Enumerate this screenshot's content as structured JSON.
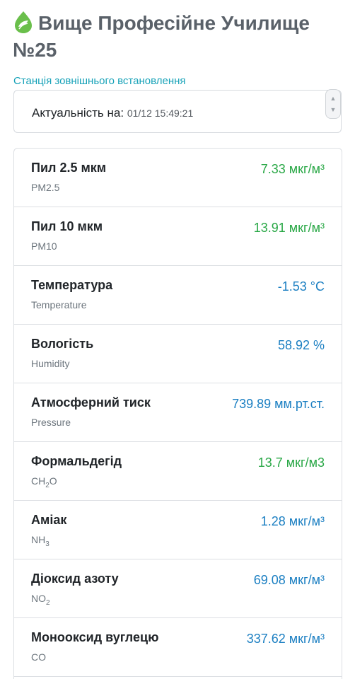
{
  "header": {
    "title": "Вище Професійне Училище №25",
    "station_link": "Станція зовнішнього встановлення",
    "actuality_label": "Актуальність на:",
    "actuality_value": "01/12 15:49:21"
  },
  "measurements": [
    {
      "name": "Пил 2.5 мкм",
      "sub": "PM2.5",
      "value": "7.33 мкг/м³",
      "status": "good"
    },
    {
      "name": "Пил 10 мкм",
      "sub": "PM10",
      "value": "13.91 мкг/м³",
      "status": "good"
    },
    {
      "name": "Температура",
      "sub": "Temperature",
      "value": "-1.53 °C",
      "status": "info"
    },
    {
      "name": "Вологість",
      "sub": "Humidity",
      "value": "58.92 %",
      "status": "info"
    },
    {
      "name": "Атмосферний тиск",
      "sub": "Pressure",
      "value": "739.89 мм.рт.ст.",
      "status": "info"
    },
    {
      "name": "Формальдегід",
      "sub_main": "CH",
      "sub_idx": "2",
      "sub_tail": "O",
      "value": "13.7 мкг/м3",
      "status": "good"
    },
    {
      "name": "Аміак",
      "sub_main": "NH",
      "sub_idx": "3",
      "value": "1.28 мкг/м³",
      "status": "info"
    },
    {
      "name": "Діоксид азоту",
      "sub_main": "NO",
      "sub_idx": "2",
      "value": "69.08 мкг/м³",
      "status": "info"
    },
    {
      "name": "Монооксид вуглецю",
      "sub": "CO",
      "value": "337.62 мкг/м³",
      "status": "info"
    }
  ],
  "colors": {
    "good": "#28a745",
    "info": "#1b7fc2",
    "accent": "#17a2b8"
  }
}
